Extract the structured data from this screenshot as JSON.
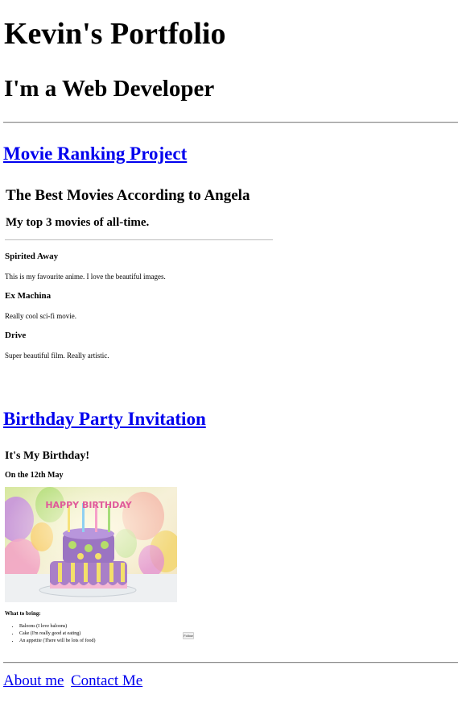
{
  "header": {
    "title": "Kevin's Portfolio",
    "subtitle": "I'm a Web Developer"
  },
  "projects": {
    "movie_link": "Movie Ranking Project",
    "birthday_link": "Birthday Party Invitation"
  },
  "movie_page": {
    "title": "The Best Movies According to Angela",
    "subtitle": "My top 3 movies of all-time.",
    "movies": [
      {
        "name": "Spirited Away",
        "description": "This is my favourite anime. I love the beautiful images."
      },
      {
        "name": "Ex Machina",
        "description": "Really cool sci-fi movie."
      },
      {
        "name": "Drive",
        "description": "Super beautiful film. Really artistic."
      }
    ]
  },
  "birthday_page": {
    "title": "It's My Birthday!",
    "date": "On the 12th May",
    "cake_topper": "HAPPY BIRTHDAY",
    "bring_heading": "What to bring:",
    "items": [
      "Baloons (I love baloons)",
      "Cake (I'm really good at eating)",
      "An appetite (There will be lots of food)"
    ],
    "button_label": "Follow"
  },
  "footer": {
    "about_link": "About me",
    "contact_link": "Contact Me"
  }
}
